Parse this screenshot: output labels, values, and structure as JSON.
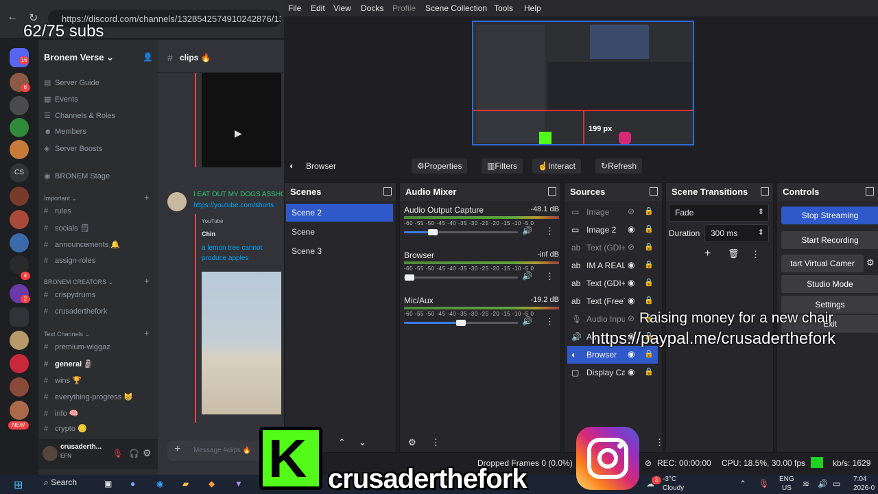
{
  "browser": {
    "url": "https://discord.com/channels/1328542574910242876/135938"
  },
  "stream_overlay": {
    "subs": "62/75 subs",
    "donation_line1": "Raising money for a new chair",
    "donation_line2": "https://paypal.me/crusaderthefork",
    "watermark": "crusaderthefork",
    "kick_letter": "K",
    "kick_icon": "kick-logo",
    "instagram_icon": "instagram-logo"
  },
  "discord": {
    "guild_badges": [
      "16",
      "6",
      "4",
      "2",
      "NEW"
    ],
    "server_name": "Bronem Verse",
    "server_menu": [
      {
        "icon": "guide-icon",
        "label": "Server Guide"
      },
      {
        "icon": "calendar-icon",
        "label": "Events"
      },
      {
        "icon": "channels-icon",
        "label": "Channels & Roles"
      },
      {
        "icon": "members-icon",
        "label": "Members"
      },
      {
        "icon": "boost-icon",
        "label": "Server Boosts"
      }
    ],
    "stage": "BRONEM Stage",
    "cat_important": "Important",
    "important_channels": [
      "rules",
      "socials 🗒",
      "announcements 🔔",
      "assign-roles"
    ],
    "cat_creators": "BRONEM CREATORS",
    "creator_channels": [
      "crispydrums",
      "crusaderthefork"
    ],
    "cat_text": "Text Channels",
    "text_channels": [
      "premium-wiggaz",
      "general 🗿",
      "wins 🏆",
      "everything-progress 😸",
      "info 🧠",
      "crypto 🪙"
    ],
    "user_name": "crusaderth...",
    "user_status": "EFN",
    "chat_channel": "clips 🔥",
    "message_text": "I EAT OUT MY DOGS ASSHOLE",
    "message_link": "https://youtube.com/shorts",
    "embed_provider": "YouTube",
    "embed_author": "Chin",
    "embed_title": "a lemon tree cannot produce apples",
    "message_placeholder": "Message #clips 🔥"
  },
  "obs": {
    "menu": [
      "File",
      "Edit",
      "View",
      "Docks",
      "Profile",
      "Scene Collection",
      "Tools",
      "Help"
    ],
    "preview_readout": "199 px",
    "source_toolbar": {
      "source": "Browser",
      "properties": "Properties",
      "filters": "Filters",
      "interact": "Interact",
      "refresh": "Refresh"
    },
    "panels": {
      "scenes": "Scenes",
      "mixer": "Audio Mixer",
      "sources": "Sources",
      "transitions": "Scene Transitions",
      "controls": "Controls"
    },
    "scenes": [
      {
        "name": "Scene 2",
        "selected": true
      },
      {
        "name": "Scene"
      },
      {
        "name": "Scene 3"
      }
    ],
    "mixer": {
      "scale": "-60 -55 -50 -45 -40 -35 -30 -25 -20 -15 -10 -5 0",
      "channels": [
        {
          "name": "Audio Output Capture",
          "db": "-48.1 dB",
          "volume": 0.25
        },
        {
          "name": "Browser",
          "db": "-inf dB",
          "volume": 0.05
        },
        {
          "name": "Mic/Aux",
          "db": "-19.2 dB",
          "volume": 0.5
        }
      ]
    },
    "sources": [
      {
        "name": "Image",
        "icon": "image-icon",
        "visible": false
      },
      {
        "name": "Image 2",
        "icon": "image-icon",
        "visible": true
      },
      {
        "name": "Text (GDI+",
        "icon": "text-icon",
        "visible": false
      },
      {
        "name": "IM A REAL",
        "icon": "text-icon",
        "visible": true
      },
      {
        "name": "Text (GDI+",
        "icon": "text-icon",
        "visible": true
      },
      {
        "name": "Text (FreeT",
        "icon": "text-icon",
        "visible": true
      },
      {
        "name": "Audio Inpu",
        "icon": "mic-icon",
        "visible": false
      },
      {
        "name": "Au",
        "icon": "speaker-icon",
        "visible": true
      },
      {
        "name": "Browser",
        "icon": "globe-icon",
        "visible": true,
        "selected": true
      },
      {
        "name": "Display Ca",
        "icon": "monitor-icon",
        "visible": true
      }
    ],
    "transition": {
      "type": "Fade",
      "duration_label": "Duration",
      "duration": "300 ms"
    },
    "controls": {
      "stream": "Stop Streaming",
      "record": "Start Recording",
      "virtual_cam": "tart Virtual Camer",
      "studio": "Studio Mode",
      "settings": "Settings",
      "exit": "Exit"
    },
    "status": {
      "dropped": "Dropped Frames 0 (0.0%)",
      "rec": "REC: 00:00:00",
      "cpu": "CPU: 18.5%, 30.00 fps",
      "kbs": "kb/s: 1629"
    }
  },
  "taskbar": {
    "search": "Search",
    "weather_temp": "-3°C",
    "weather_text": "Cloudy",
    "weather_alerts": "3",
    "lang1": "ENG",
    "lang2": "US",
    "time": "7:04",
    "date": "2026-0"
  }
}
